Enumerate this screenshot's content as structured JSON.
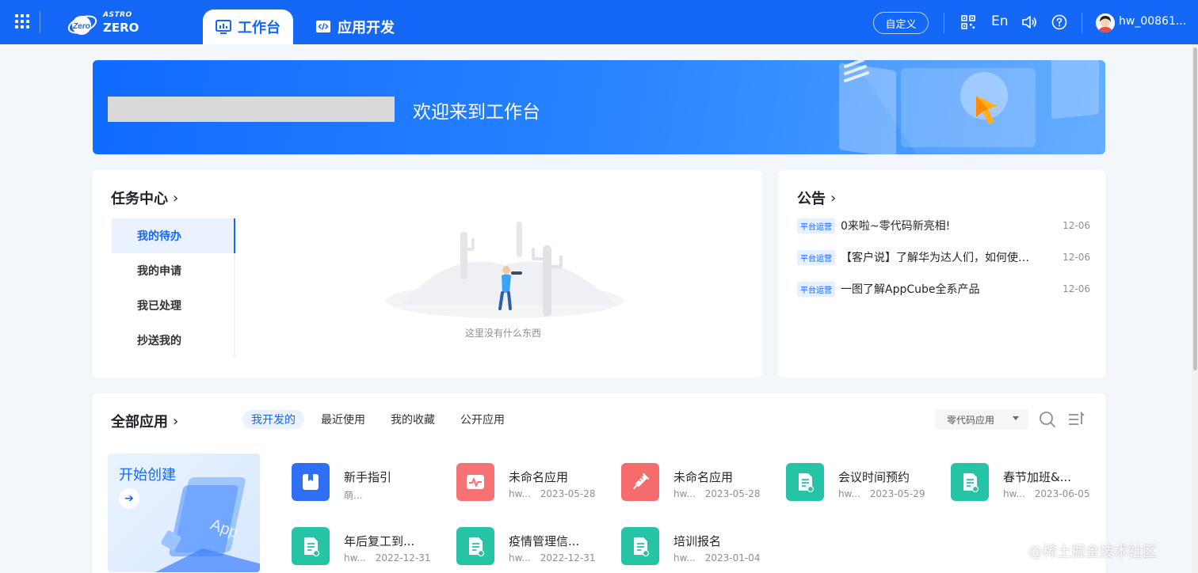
{
  "header": {
    "logo_top": "ASTRO",
    "logo_bottom": "ZERO",
    "logo_badge": "Zero",
    "tabs": [
      {
        "label": "工作台",
        "icon": "monitor-chart-icon"
      },
      {
        "label": "应用开发",
        "icon": "code-window-icon"
      }
    ],
    "customize_label": "自定义",
    "lang_label": "En",
    "username": "hw_00861...",
    "icons": [
      "apps-grid-icon",
      "qrcode-icon",
      "speaker-icon",
      "help-icon"
    ]
  },
  "banner": {
    "welcome": "欢迎来到工作台"
  },
  "task_center": {
    "title": "任务中心",
    "menu": [
      "我的待办",
      "我的申请",
      "我已处理",
      "抄送我的"
    ],
    "active_index": 0,
    "empty_text": "这里没有什么东西"
  },
  "notice": {
    "title": "公告",
    "items": [
      {
        "tag": "平台运营",
        "title": "0来啦~零代码新亮相!",
        "date": "12-06"
      },
      {
        "tag": "平台运营",
        "title": "【客户说】了解华为达人们，如何使用...",
        "date": "12-06"
      },
      {
        "tag": "平台运营",
        "title": "一图了解AppCube全系产品",
        "date": "12-06"
      }
    ]
  },
  "apps": {
    "title": "全部应用",
    "tabs": [
      "我开发的",
      "最近使用",
      "我的收藏",
      "公开应用"
    ],
    "active_tab": 0,
    "filter_value": "零代码应用",
    "create_label": "开始创建",
    "create_art_text": "App",
    "items": [
      {
        "name": "新手指引",
        "owner": "萌...",
        "date": "",
        "color": "#2f6ff5",
        "icon": "bookmark-icon"
      },
      {
        "name": "未命名应用",
        "owner": "hw...",
        "date": "2023-05-28",
        "color": "#f77272",
        "icon": "pulse-icon"
      },
      {
        "name": "未命名应用",
        "owner": "hw...",
        "date": "2023-05-28",
        "color": "#f56c6c",
        "icon": "syringe-icon"
      },
      {
        "name": "会议时间预约",
        "owner": "hw...",
        "date": "2023-05-29",
        "color": "#26c4a7",
        "icon": "document-icon"
      },
      {
        "name": "春节加班&...",
        "owner": "hw...",
        "date": "2023-06-05",
        "color": "#26c4a7",
        "icon": "document-icon"
      },
      {
        "name": "年后复工到...",
        "owner": "hw...",
        "date": "2022-12-31",
        "color": "#26c4a7",
        "icon": "document-icon"
      },
      {
        "name": "疫情管理信...",
        "owner": "hw...",
        "date": "2022-12-31",
        "color": "#26c4a7",
        "icon": "document-icon"
      },
      {
        "name": "培训报名",
        "owner": "hw...",
        "date": "2023-01-04",
        "color": "#26c4a7",
        "icon": "document-icon"
      }
    ]
  },
  "watermark": "@稀土掘金技术社区"
}
